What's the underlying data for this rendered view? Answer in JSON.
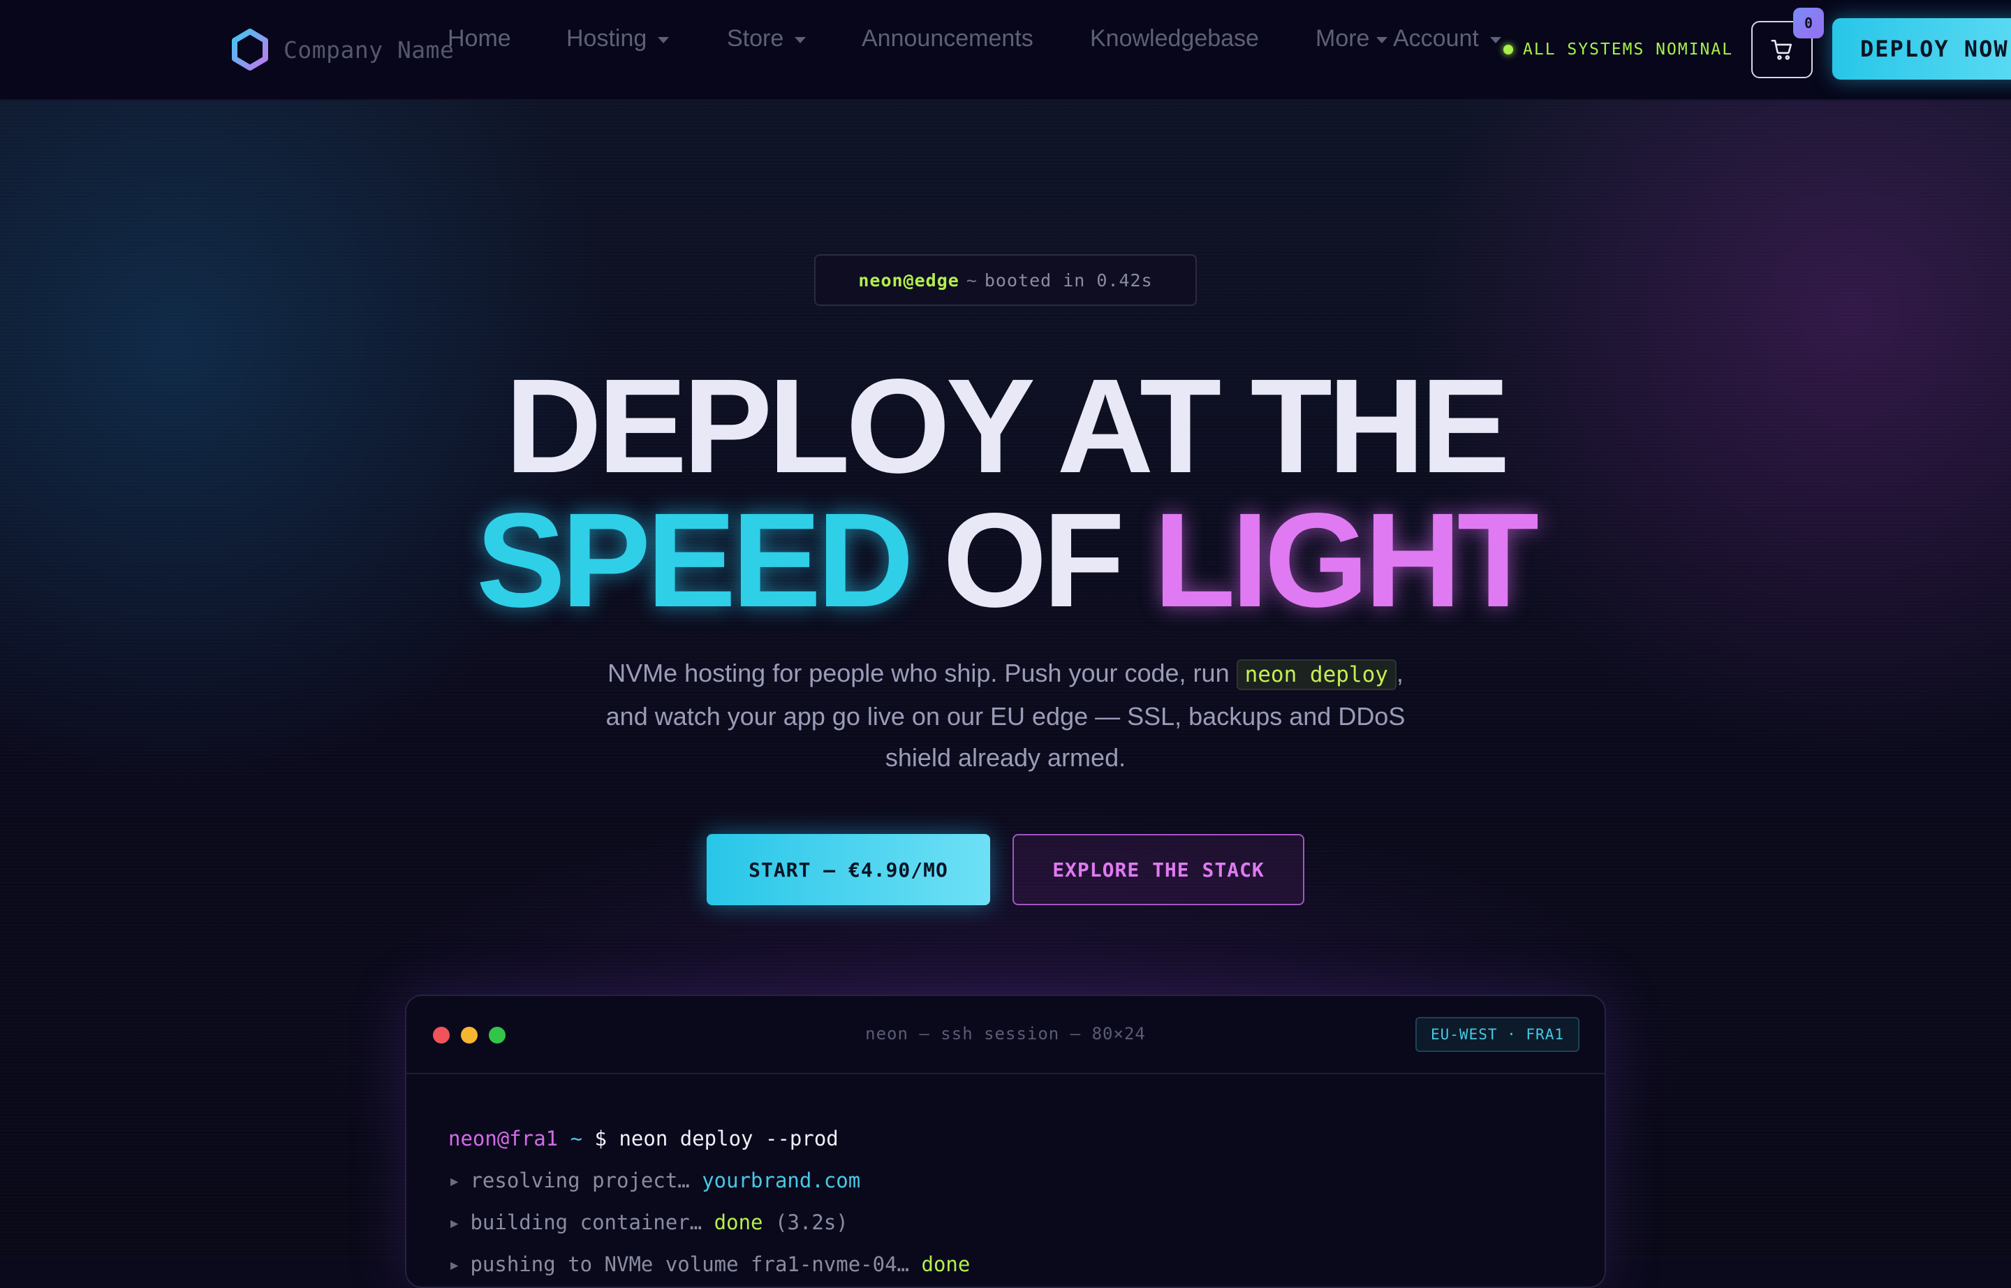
{
  "nav": {
    "brand_name": "Company Name",
    "items": [
      {
        "label": "Home",
        "dropdown": false
      },
      {
        "label": "Hosting",
        "dropdown": true
      },
      {
        "label": "Store",
        "dropdown": true
      },
      {
        "label": "Announcements",
        "dropdown": false
      },
      {
        "label": "Knowledgebase",
        "dropdown": false
      },
      {
        "label": "More",
        "dropdown": true
      },
      {
        "label": "Account",
        "dropdown": true
      }
    ],
    "status": "ALL SYSTEMS NOMINAL",
    "cart_count": "0",
    "deploy_label": "DEPLOY NOW"
  },
  "hero": {
    "pill_user": "neon@edge",
    "pill_sep": "~",
    "pill_text": "booted in 0.42s",
    "title_line1": "DEPLOY AT THE",
    "title_speed": "SPEED",
    "title_of": "OF",
    "title_light": "LIGHT",
    "lead_before": "NVMe hosting for people who ship. Push your code, run ",
    "lead_code": "neon deploy",
    "lead_after": ", and watch your app go live on our EU edge — SSL, backups and DDoS shield already armed.",
    "cta_primary": "START — €4.90/MO",
    "cta_secondary": "EXPLORE THE STACK"
  },
  "terminal": {
    "title": "neon — ssh session — 80×24",
    "region": "EU-WEST · FRA1",
    "prompt_user": "neon@fra1",
    "prompt_tilde": "~",
    "prompt_cmd": "$ neon deploy --prod",
    "line1_text": "resolving project…",
    "line1_value": "yourbrand.com",
    "line2_text": "building container…",
    "line2_status": "done",
    "line2_time": "(3.2s)",
    "line3_text": "pushing to NVMe volume fra1-nvme-04…",
    "line3_status": "done"
  },
  "colors": {
    "accent_cyan": "#2fcfe8",
    "accent_pink": "#e07af2",
    "accent_lime": "#b4ef4c",
    "background": "#0b0a1c"
  },
  "icons": [
    "hexagon-logo-icon",
    "chevron-down-icon",
    "status-dot-icon",
    "cart-icon",
    "arrow-right-icon"
  ]
}
